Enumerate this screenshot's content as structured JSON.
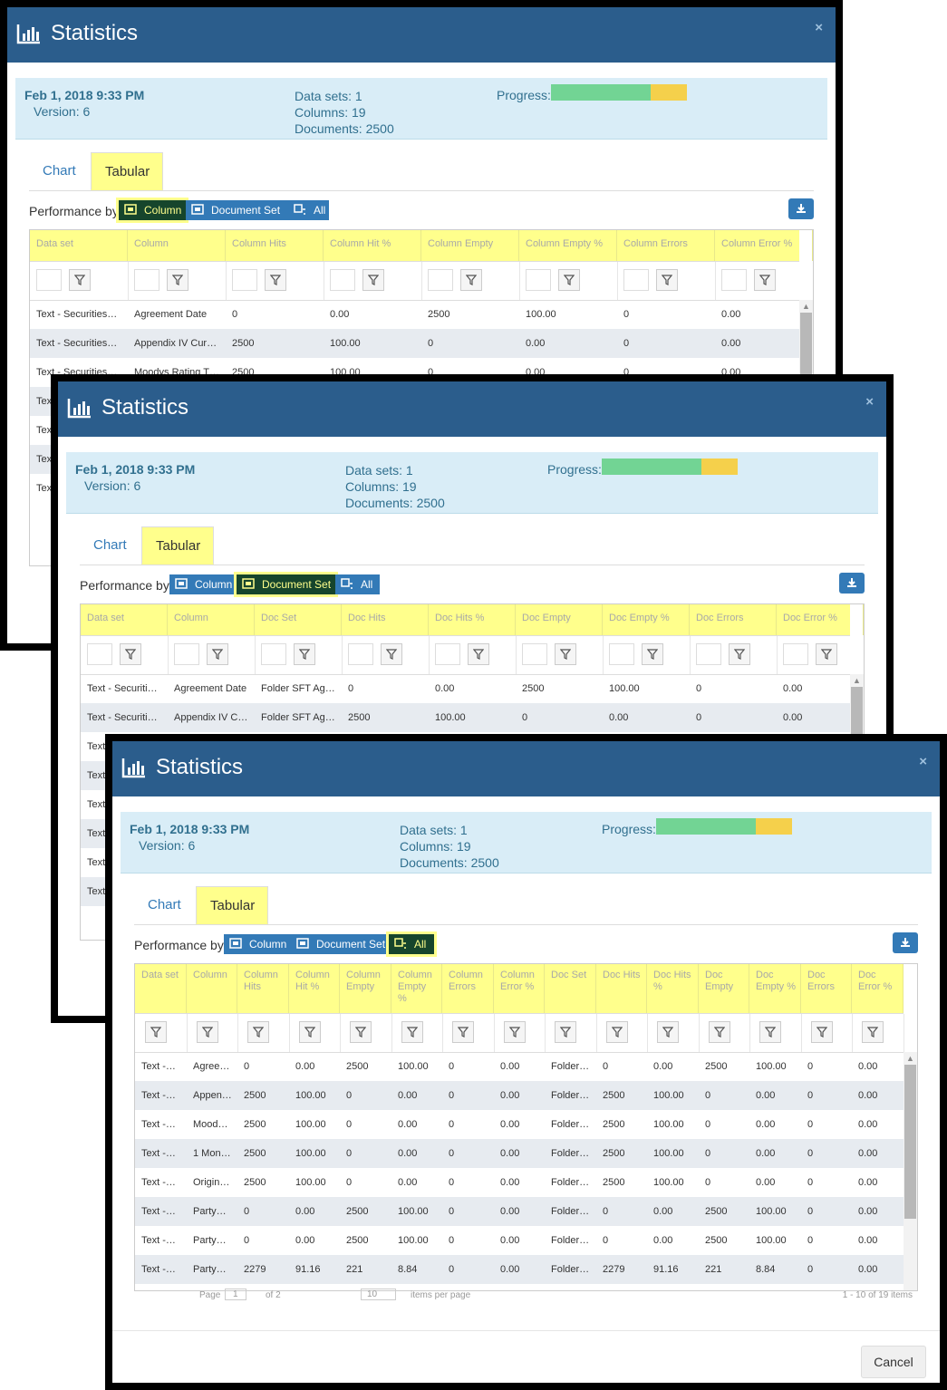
{
  "dialog": {
    "title": "Statistics",
    "close": "×",
    "date": "Feb 1, 2018 9:33 PM",
    "version": "Version: 6",
    "datasets": "Data sets: 1",
    "columns": "Columns: 19",
    "documents": "Documents: 2500",
    "progress_label": "Progress:",
    "progress_fraction": 0.73,
    "tab_chart": "Chart",
    "tab_tabular": "Tabular",
    "perf_label": "Performance by:",
    "btn_column": "Column",
    "btn_docset": "Document Set",
    "btn_all": "All",
    "cancel": "Cancel"
  },
  "d1": {
    "headers": [
      "Data set",
      "Column",
      "Column Hits",
      "Column Hit %",
      "Column Empty",
      "Column Empty %",
      "Column Errors",
      "Column Error %"
    ],
    "rows": [
      [
        "Text - Securities…",
        "Agreement Date",
        "0",
        "0.00",
        "2500",
        "100.00",
        "0",
        "0.00"
      ],
      [
        "Text - Securities…",
        "Appendix IV Cur…",
        "2500",
        "100.00",
        "0",
        "0.00",
        "0",
        "0.00"
      ],
      [
        "Text - Securities…",
        "Moodys Rating T…",
        "2500",
        "100.00",
        "0",
        "0.00",
        "0",
        "0.00"
      ],
      [
        "Text",
        "",
        "",
        "",
        "",
        "",
        "",
        ""
      ],
      [
        "Text",
        "",
        "",
        "",
        "",
        "",
        "",
        ""
      ],
      [
        "Text",
        "",
        "",
        "",
        "",
        "",
        "",
        ""
      ],
      [
        "Text",
        "",
        "",
        "",
        "",
        "",
        "",
        ""
      ]
    ]
  },
  "d2": {
    "headers": [
      "Data set",
      "Column",
      "Doc Set",
      "Doc Hits",
      "Doc Hits %",
      "Doc Empty",
      "Doc Empty %",
      "Doc Errors",
      "Doc Error %"
    ],
    "rows": [
      [
        "Text - Securiti…",
        "Agreement Date",
        "Folder SFT Ag…",
        "0",
        "0.00",
        "2500",
        "100.00",
        "0",
        "0.00"
      ],
      [
        "Text - Securiti…",
        "Appendix IV C…",
        "Folder SFT Ag…",
        "2500",
        "100.00",
        "0",
        "0.00",
        "0",
        "0.00"
      ],
      [
        "Text",
        "",
        "",
        "",
        "",
        "",
        "",
        "",
        ""
      ],
      [
        "Text",
        "",
        "",
        "",
        "",
        "",
        "",
        "",
        ""
      ],
      [
        "Text",
        "",
        "",
        "",
        "",
        "",
        "",
        "",
        ""
      ],
      [
        "Text",
        "",
        "",
        "",
        "",
        "",
        "",
        "",
        ""
      ],
      [
        "Text",
        "",
        "",
        "",
        "",
        "",
        "",
        "",
        ""
      ],
      [
        "Text",
        "",
        "",
        "",
        "",
        "",
        "",
        "",
        ""
      ]
    ]
  },
  "d3": {
    "headers": [
      "Data set",
      "Column",
      "Column Hits",
      "Column Hit %",
      "Column Empty",
      "Column Empty %",
      "Column Errors",
      "Column Error %",
      "Doc Set",
      "Doc Hits",
      "Doc Hits %",
      "Doc Empty",
      "Doc Empty %",
      "Doc Errors",
      "Doc Error %"
    ],
    "rows": [
      [
        "Text -…",
        "Agree…",
        "0",
        "0.00",
        "2500",
        "100.00",
        "0",
        "0.00",
        "Folder…",
        "0",
        "0.00",
        "2500",
        "100.00",
        "0",
        "0.00"
      ],
      [
        "Text -…",
        "Appen…",
        "2500",
        "100.00",
        "0",
        "0.00",
        "0",
        "0.00",
        "Folder…",
        "2500",
        "100.00",
        "0",
        "0.00",
        "0",
        "0.00"
      ],
      [
        "Text -…",
        "Mood…",
        "2500",
        "100.00",
        "0",
        "0.00",
        "0",
        "0.00",
        "Folder…",
        "2500",
        "100.00",
        "0",
        "0.00",
        "0",
        "0.00"
      ],
      [
        "Text -…",
        "1 Mon…",
        "2500",
        "100.00",
        "0",
        "0.00",
        "0",
        "0.00",
        "Folder…",
        "2500",
        "100.00",
        "0",
        "0.00",
        "0",
        "0.00"
      ],
      [
        "Text -…",
        "Origin…",
        "2500",
        "100.00",
        "0",
        "0.00",
        "0",
        "0.00",
        "Folder…",
        "2500",
        "100.00",
        "0",
        "0.00",
        "0",
        "0.00"
      ],
      [
        "Text -…",
        "Party…",
        "0",
        "0.00",
        "2500",
        "100.00",
        "0",
        "0.00",
        "Folder…",
        "0",
        "0.00",
        "2500",
        "100.00",
        "0",
        "0.00"
      ],
      [
        "Text -…",
        "Party…",
        "0",
        "0.00",
        "2500",
        "100.00",
        "0",
        "0.00",
        "Folder…",
        "0",
        "0.00",
        "2500",
        "100.00",
        "0",
        "0.00"
      ],
      [
        "Text -…",
        "Party…",
        "2279",
        "91.16",
        "221",
        "8.84",
        "0",
        "0.00",
        "Folder…",
        "2279",
        "91.16",
        "221",
        "8.84",
        "0",
        "0.00"
      ]
    ],
    "pager_page": "Page",
    "pager_page_value": "1",
    "pager_of": "of 2",
    "pager_size": "10",
    "pager_items_per_page": "items per page",
    "pager_summary": "1 - 10 of 19 items"
  },
  "colors": {
    "header": "#2b5d8c",
    "highlight": "#ffff8c",
    "button": "#337ab7",
    "selected": "#16452c",
    "progress_green": "#72d494",
    "progress_yellow": "#f5d04b"
  }
}
